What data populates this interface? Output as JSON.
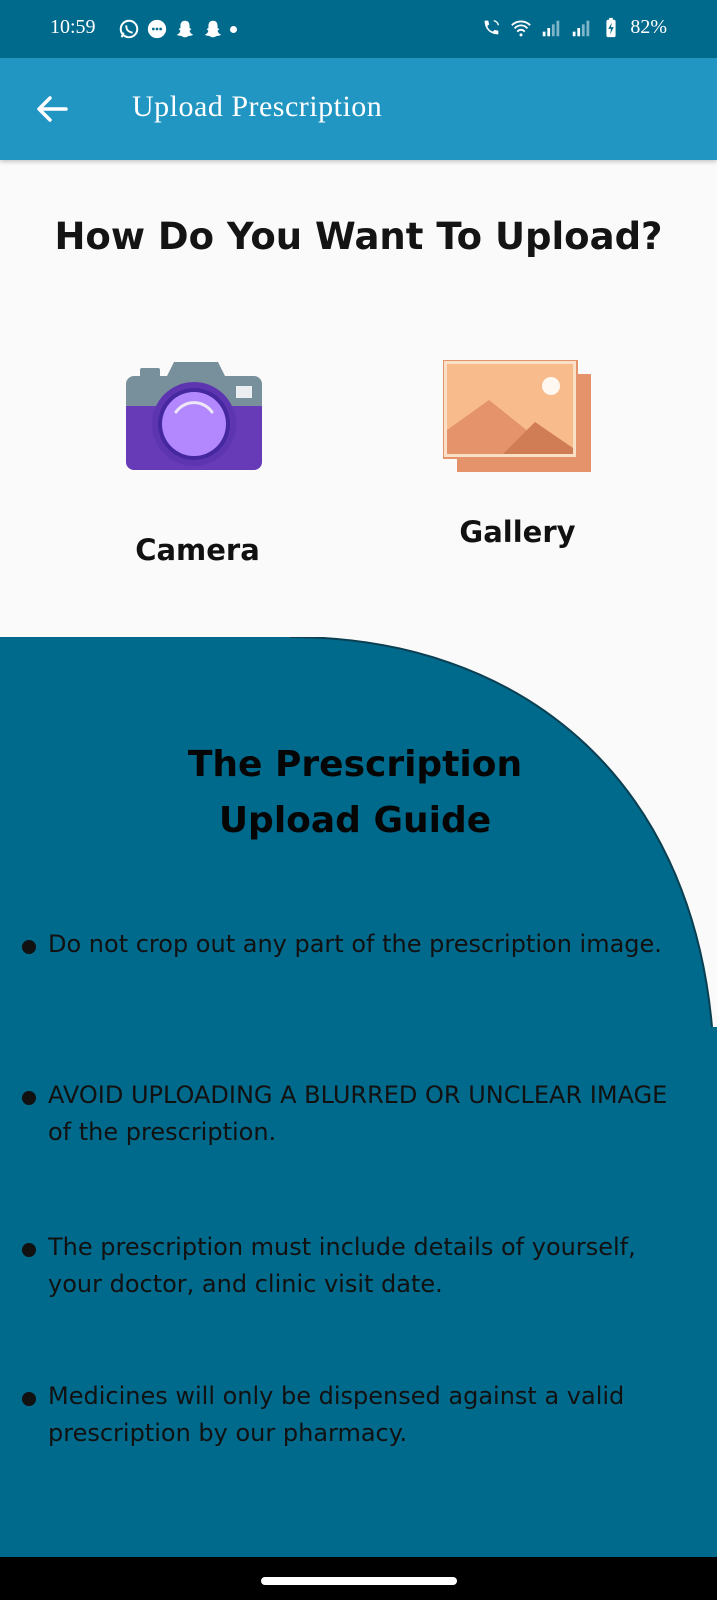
{
  "status_bar": {
    "time": "10:59",
    "battery": "82%",
    "left_icons": [
      "whatsapp-icon",
      "message-icon",
      "snapchat-icon",
      "snapchat-icon",
      "dot-icon"
    ],
    "right_icons": [
      "wifi-call-icon",
      "wifi-icon",
      "signal-icon",
      "signal-icon",
      "battery-charging-icon"
    ]
  },
  "app_bar": {
    "title": "Upload Prescription",
    "back_icon": "arrow-left-icon"
  },
  "main": {
    "heading": "How Do You Want To Upload?",
    "options": [
      {
        "label": "Camera",
        "icon": "camera-icon"
      },
      {
        "label": "Gallery",
        "icon": "gallery-icon"
      }
    ]
  },
  "guide": {
    "title_line1": "The Prescription",
    "title_line2": "Upload Guide",
    "items": [
      "Do not crop out any part of the prescription image.",
      "AVOID UPLOADING A BLURRED OR UNCLEAR IMAGE of the prescription.",
      "The prescription must include details of yourself, your doctor, and clinic visit date.",
      "Medicines will only be dispensed against a valid prescription by our pharmacy."
    ]
  },
  "colors": {
    "status_bar": "#006a8c",
    "app_bar": "#2196c3",
    "guide_panel": "#006a8c",
    "background": "#fafafa"
  }
}
